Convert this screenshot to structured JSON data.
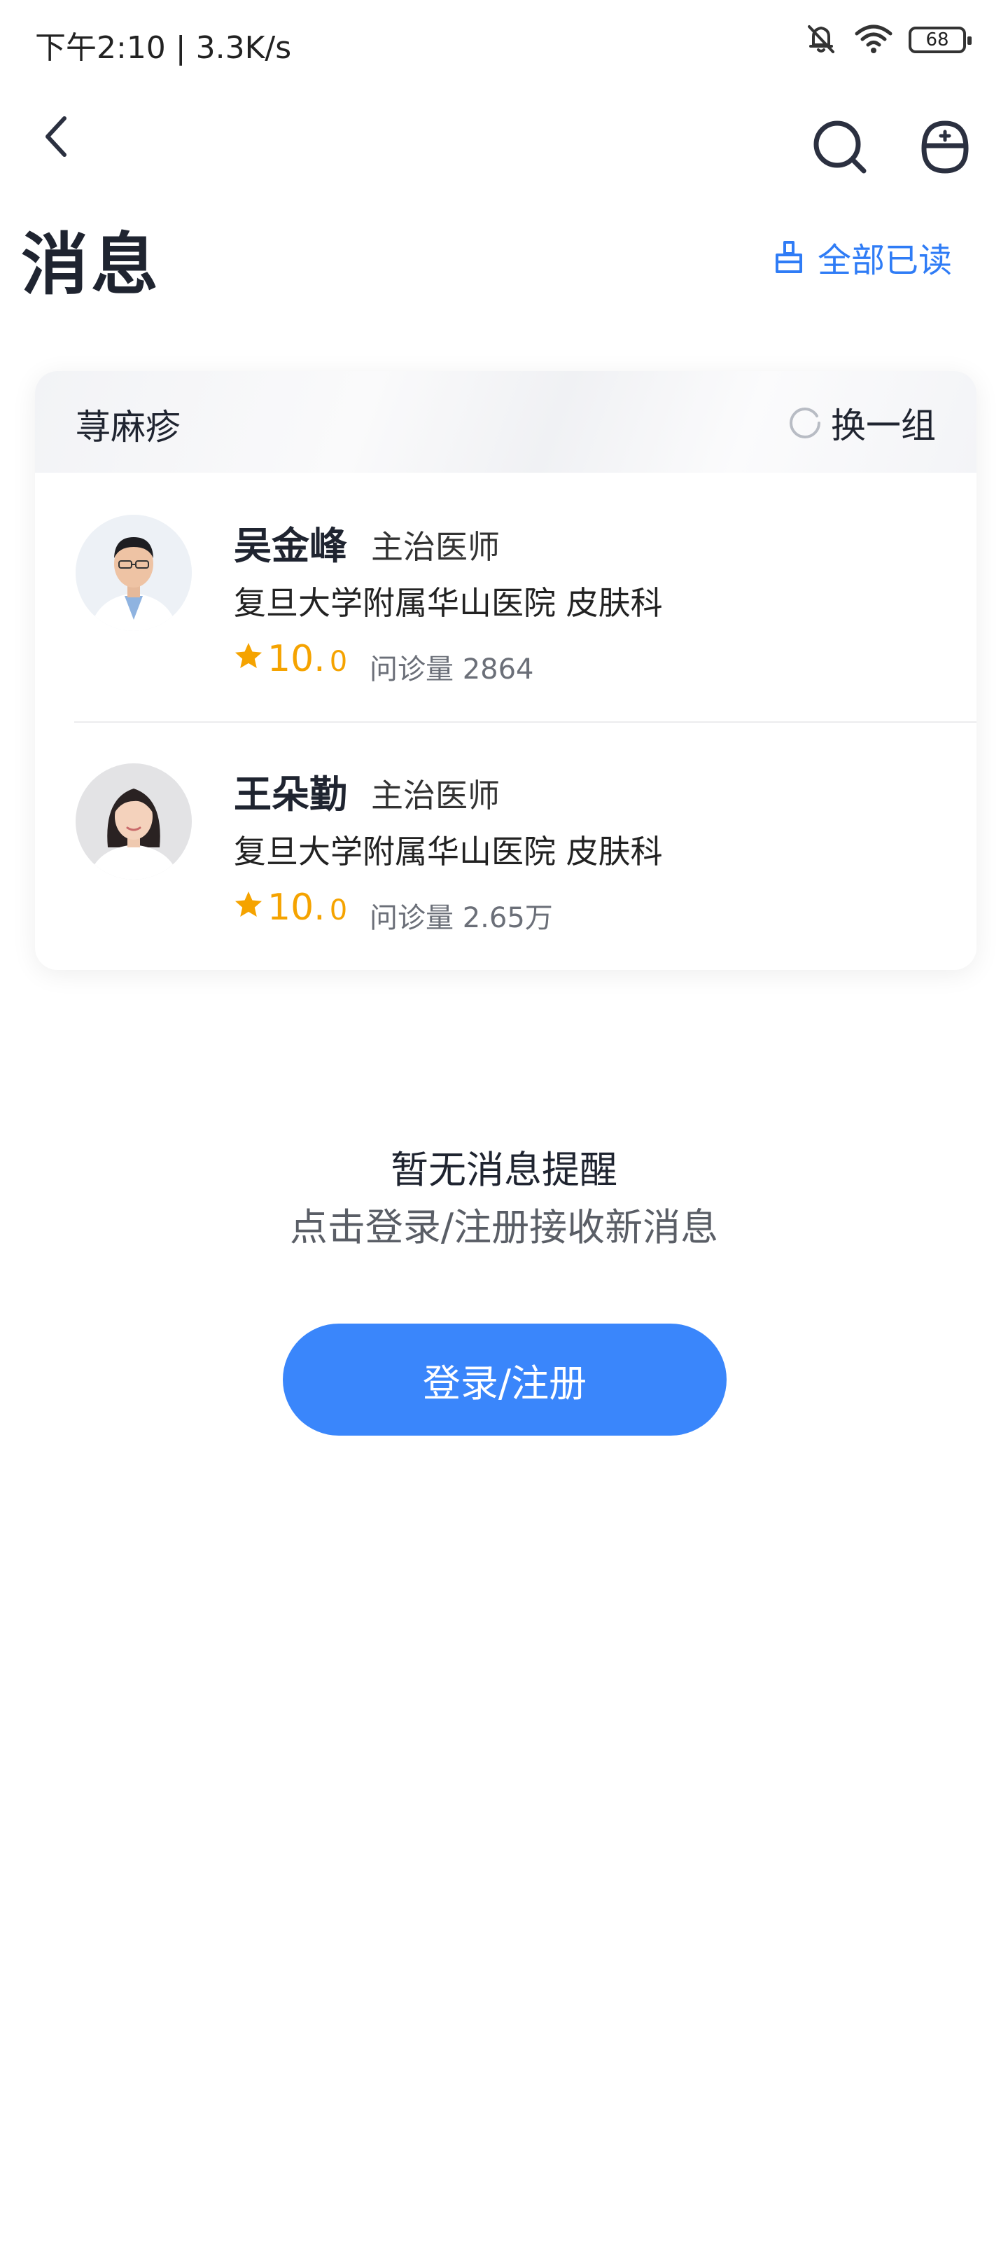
{
  "status_bar": {
    "time_speed": "下午2:10 | 3.3K/s",
    "battery": "68",
    "icons": [
      "bell-off-icon",
      "wifi-icon",
      "battery-icon"
    ]
  },
  "nav": {
    "icons": [
      "back-icon",
      "search-icon",
      "customer-service-icon"
    ]
  },
  "header": {
    "title": "消息",
    "mark_all_read": "全部已读"
  },
  "card": {
    "title": "荨麻疹",
    "refresh_label": "换一组",
    "doctors": [
      {
        "name": "吴金峰",
        "title": "主治医师",
        "hospital": "复旦大学附属华山医院 皮肤科",
        "rating_int": "10.",
        "rating_dec": "0",
        "consult": "问诊量 2864"
      },
      {
        "name": "王朵勤",
        "title": "主治医师",
        "hospital": "复旦大学附属华山医院 皮肤科",
        "rating_int": "10.",
        "rating_dec": "0",
        "consult": "问诊量 2.65万"
      }
    ]
  },
  "empty_state": {
    "title": "暂无消息提醒",
    "subtitle": "点击登录/注册接收新消息",
    "button": "登录/注册"
  },
  "colors": {
    "accent": "#3a86fb",
    "link": "#2f7cf6",
    "star": "#f5a300"
  }
}
